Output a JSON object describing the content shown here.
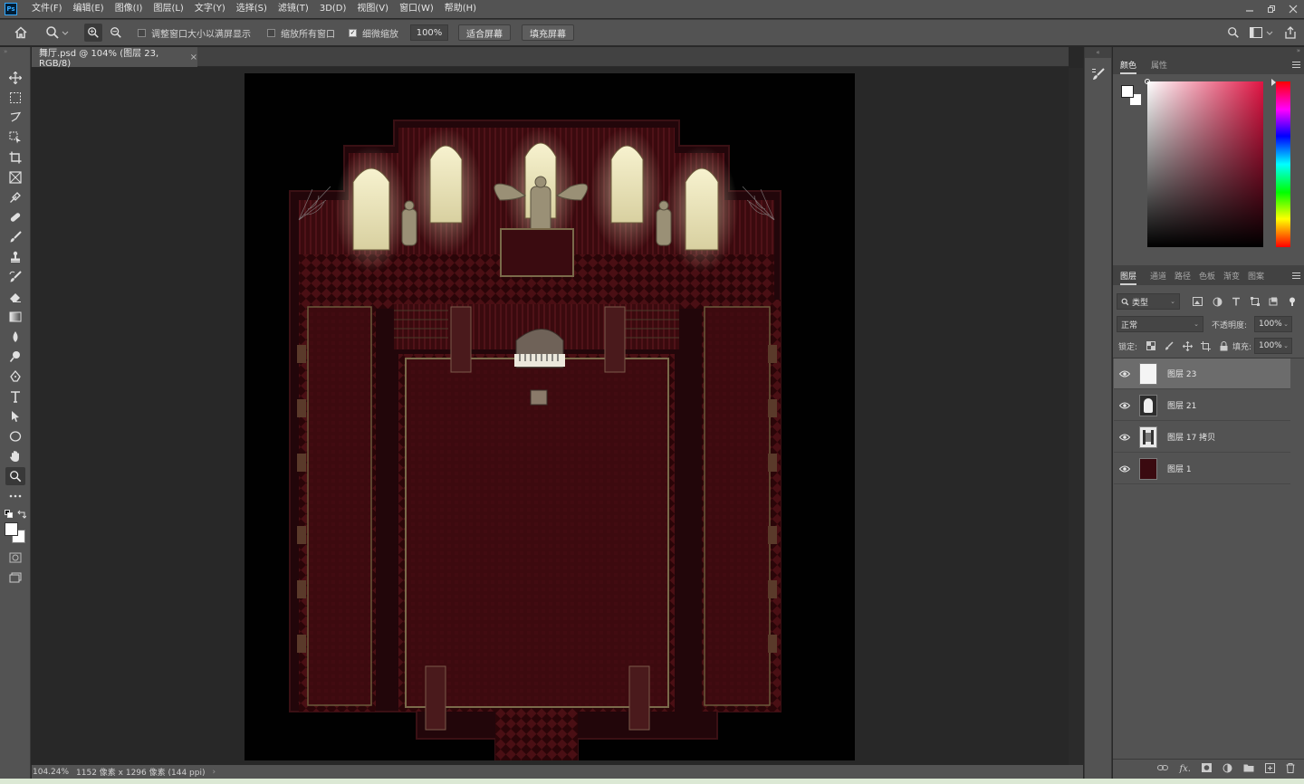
{
  "app": {
    "logo": "Ps"
  },
  "menu": [
    "文件(F)",
    "编辑(E)",
    "图像(I)",
    "图层(L)",
    "文字(Y)",
    "选择(S)",
    "滤镜(T)",
    "3D(D)",
    "视图(V)",
    "窗口(W)",
    "帮助(H)"
  ],
  "options_bar": {
    "resize_windows_label": "调整窗口大小以满屏显示",
    "resize_windows_checked": false,
    "zoom_all_windows_label": "缩放所有窗口",
    "zoom_all_windows_checked": false,
    "scrubby_zoom_label": "细微缩放",
    "scrubby_zoom_checked": true,
    "zoom_value": "100%",
    "fit_screen_label": "适合屏幕",
    "fill_screen_label": "填充屏幕"
  },
  "document": {
    "tab_title": "舞厅.psd @ 104% (图层 23, RGB/8)",
    "close_glyph": "×",
    "status_zoom": "104.24%",
    "status_info": "1152 像素 x 1296 像素 (144 ppi)",
    "status_arrow": "›"
  },
  "color_panel": {
    "tabs": [
      "颜色",
      "属性"
    ],
    "active_tab": 0,
    "foreground": "#ffffff",
    "background": "#ffffff",
    "field_hue": "#e01443"
  },
  "layers_panel": {
    "tabs": [
      "图层",
      "通道",
      "路径",
      "色板",
      "渐变",
      "图案"
    ],
    "active_tab": 0,
    "filter_kind": "类型",
    "blend_mode": "正常",
    "opacity_label": "不透明度:",
    "opacity_value": "100%",
    "lock_label": "锁定:",
    "fill_label": "填充:",
    "fill_value": "100%",
    "layers": [
      {
        "name": "图层 23",
        "visible": true,
        "selected": true,
        "thumb": "white"
      },
      {
        "name": "图层 21",
        "visible": true,
        "selected": false,
        "thumb": "white"
      },
      {
        "name": "图层 17 拷贝",
        "visible": true,
        "selected": false,
        "thumb": "pattern"
      },
      {
        "name": "图层 1",
        "visible": true,
        "selected": false,
        "thumb": "dark-red"
      }
    ]
  },
  "tools": [
    "move-tool",
    "marquee-tool",
    "lasso-tool",
    "object-select-tool",
    "crop-tool",
    "frame-tool",
    "eyedropper-tool",
    "healing-brush-tool",
    "brush-tool",
    "clone-stamp-tool",
    "history-brush-tool",
    "eraser-tool",
    "gradient-tool",
    "blur-tool",
    "dodge-tool",
    "pen-tool",
    "type-tool",
    "path-select-tool",
    "ellipse-tool",
    "hand-tool",
    "zoom-tool"
  ],
  "active_tool": "zoom-tool",
  "colors": {
    "chrome": "#535353",
    "chrome_dark": "#424242",
    "workspace": "#282828",
    "floor": "#3a0c10",
    "carpet": "#4a1216",
    "accent_gold": "#6b5a3a"
  }
}
